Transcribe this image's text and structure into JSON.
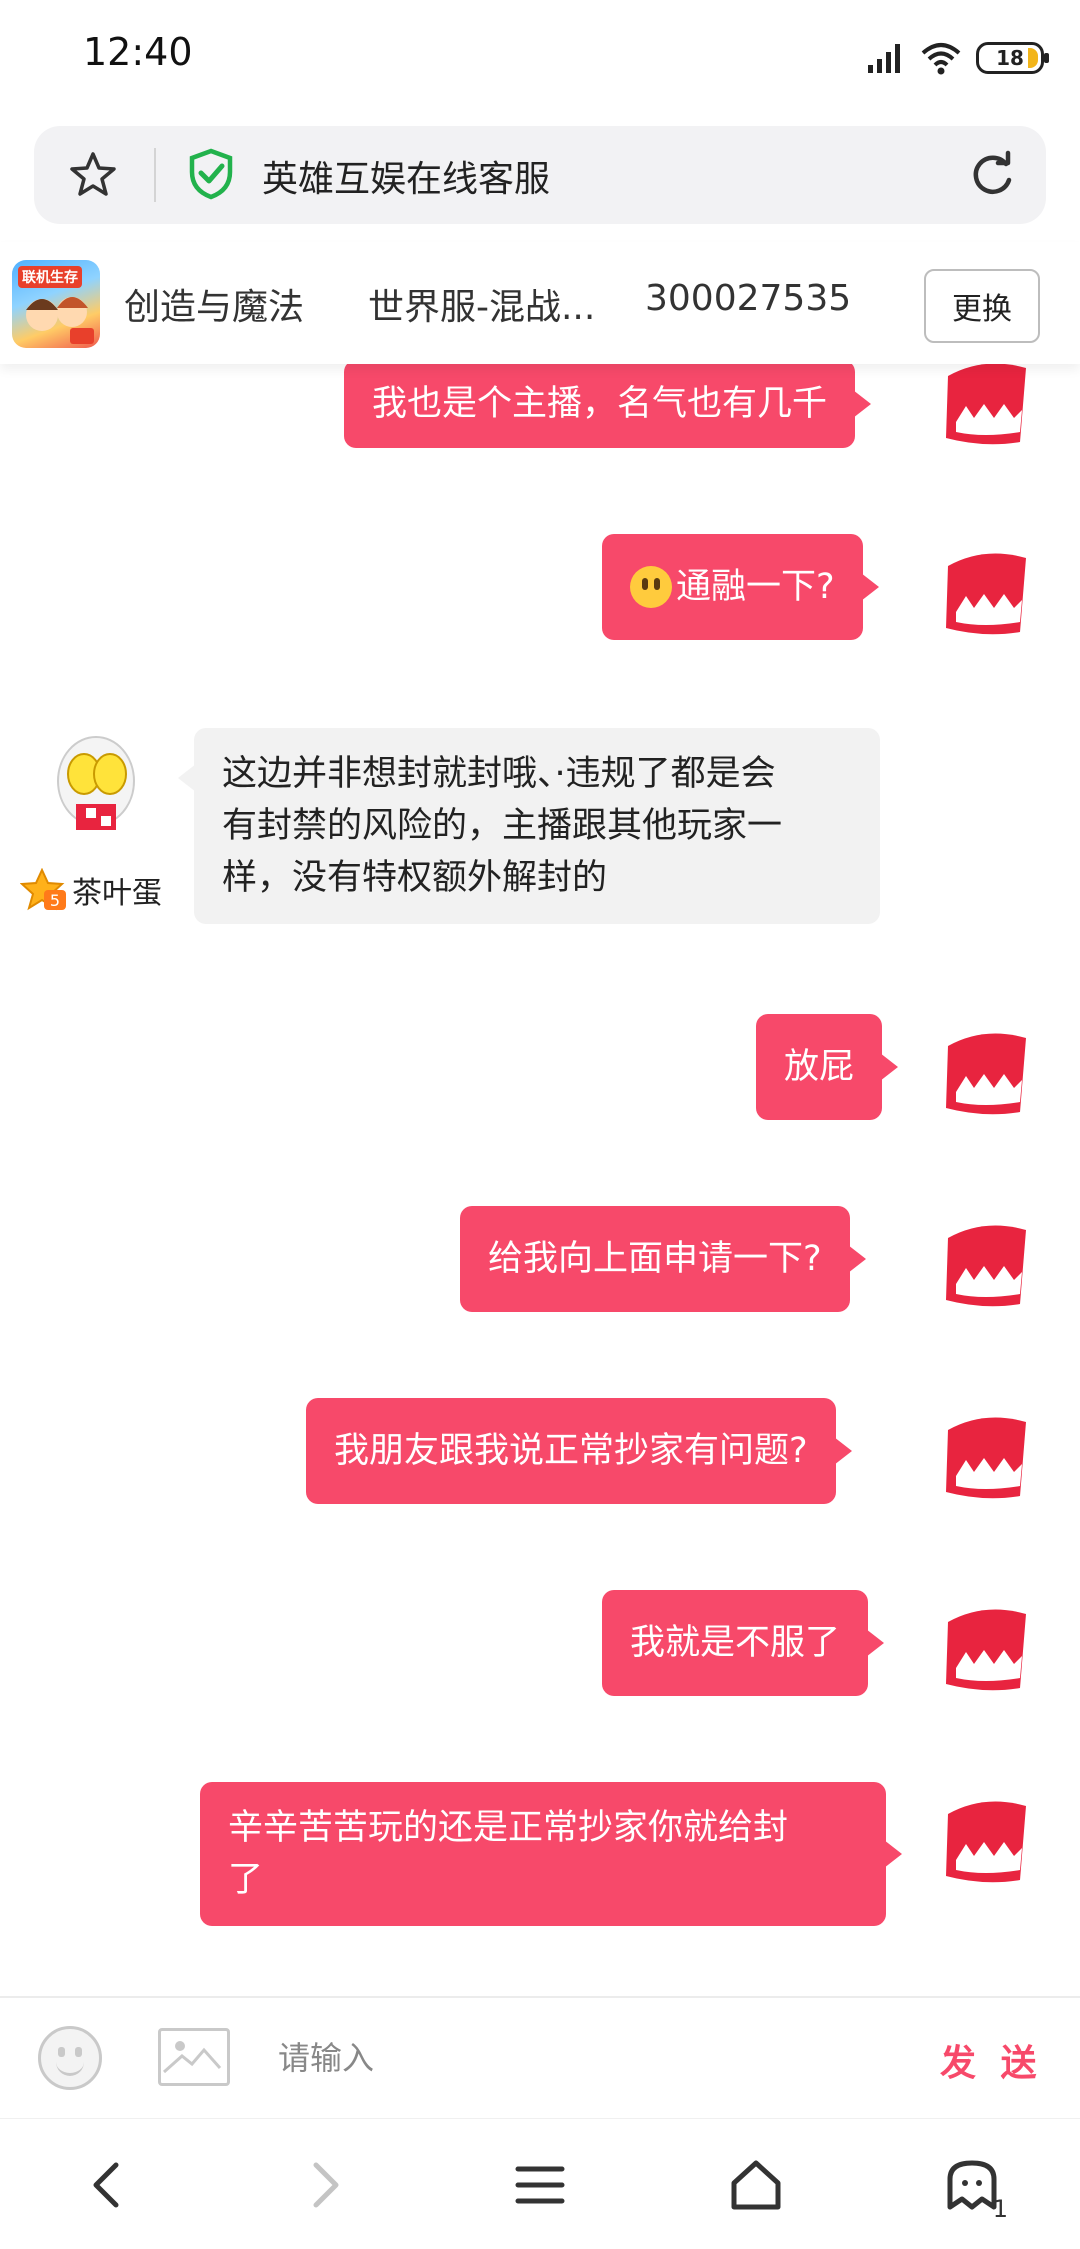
{
  "status_bar": {
    "time": "12:40",
    "battery": "18"
  },
  "address_bar": {
    "title": "英雄互娱在线客服"
  },
  "game": {
    "name": "创造与魔法",
    "server": "世界服-混战...",
    "id": "300027535",
    "switch_label": "更换"
  },
  "messages": [
    {
      "from": "user",
      "text": "我也是个主播，名气也有几千"
    },
    {
      "from": "user",
      "text": "通融一下?",
      "emoji": "neutral-face"
    },
    {
      "from": "agent",
      "name": "茶叶蛋",
      "lines": [
        "这边并非想封就封哦、·违规了都是会",
        "有封禁的风险的，主播跟其他玩家一",
        "样，没有特权额外解封的"
      ]
    },
    {
      "from": "user",
      "text": "放屁"
    },
    {
      "from": "user",
      "text": "给我向上面申请一下?"
    },
    {
      "from": "user",
      "text": "我朋友跟我说正常抄家有问题?"
    },
    {
      "from": "user",
      "text": "我就是不服了"
    },
    {
      "from": "user",
      "lines": [
        "辛辛苦苦玩的还是正常抄家你就给封",
        "了"
      ]
    }
  ],
  "input": {
    "placeholder": "请输入",
    "send_label": "发 送"
  },
  "nav": {
    "tabs_count": "1"
  },
  "colors": {
    "accent": "#f7496a",
    "agent_bubble": "#f2f2f2"
  },
  "game_thumb_text": "联机生存"
}
